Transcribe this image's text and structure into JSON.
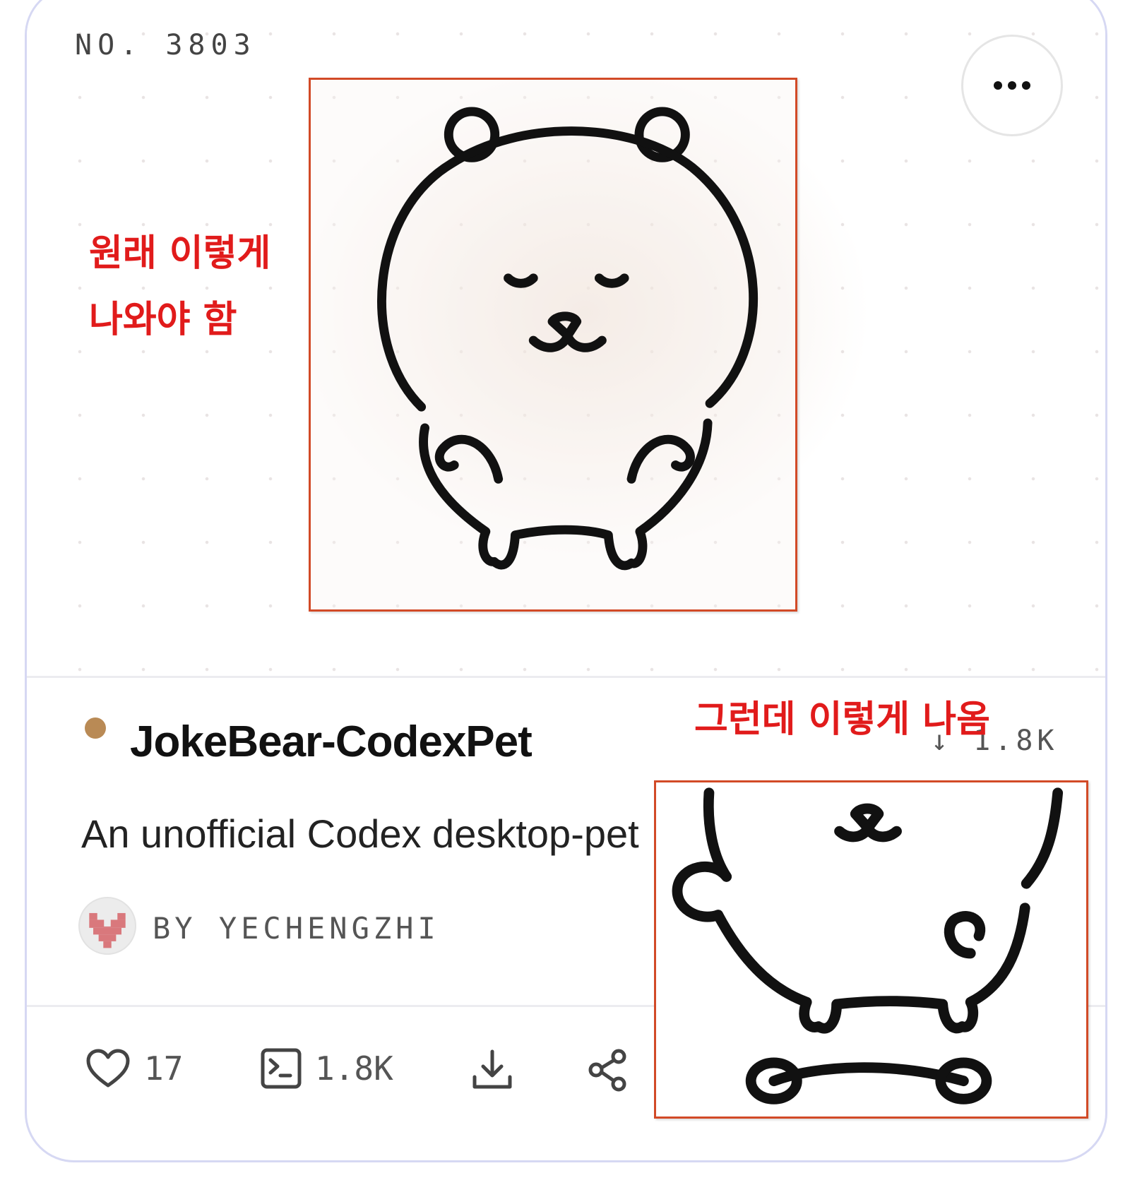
{
  "card": {
    "number": "NO. 3803",
    "name": "JokeBear-CodexPet",
    "downloads_badge": "↓ 1.8K",
    "description": "An unofficial Codex desktop-pet",
    "author": "BY YECHENGZHI"
  },
  "actions": {
    "likes": "17",
    "runs": "1.8K"
  },
  "annotations": {
    "expected_line1": "원래 이렇게",
    "expected_line2": "나와야 함",
    "actual": "그런데 이렇게 나옴"
  },
  "icons": [
    "more-icon",
    "heart-icon",
    "terminal-icon",
    "download-icon",
    "share-icon"
  ],
  "colors": {
    "status_dot": "#b98a55",
    "annotation_red": "#e11b1b",
    "annotation_box": "#d24a27",
    "card_border": "#d6d8f3"
  }
}
